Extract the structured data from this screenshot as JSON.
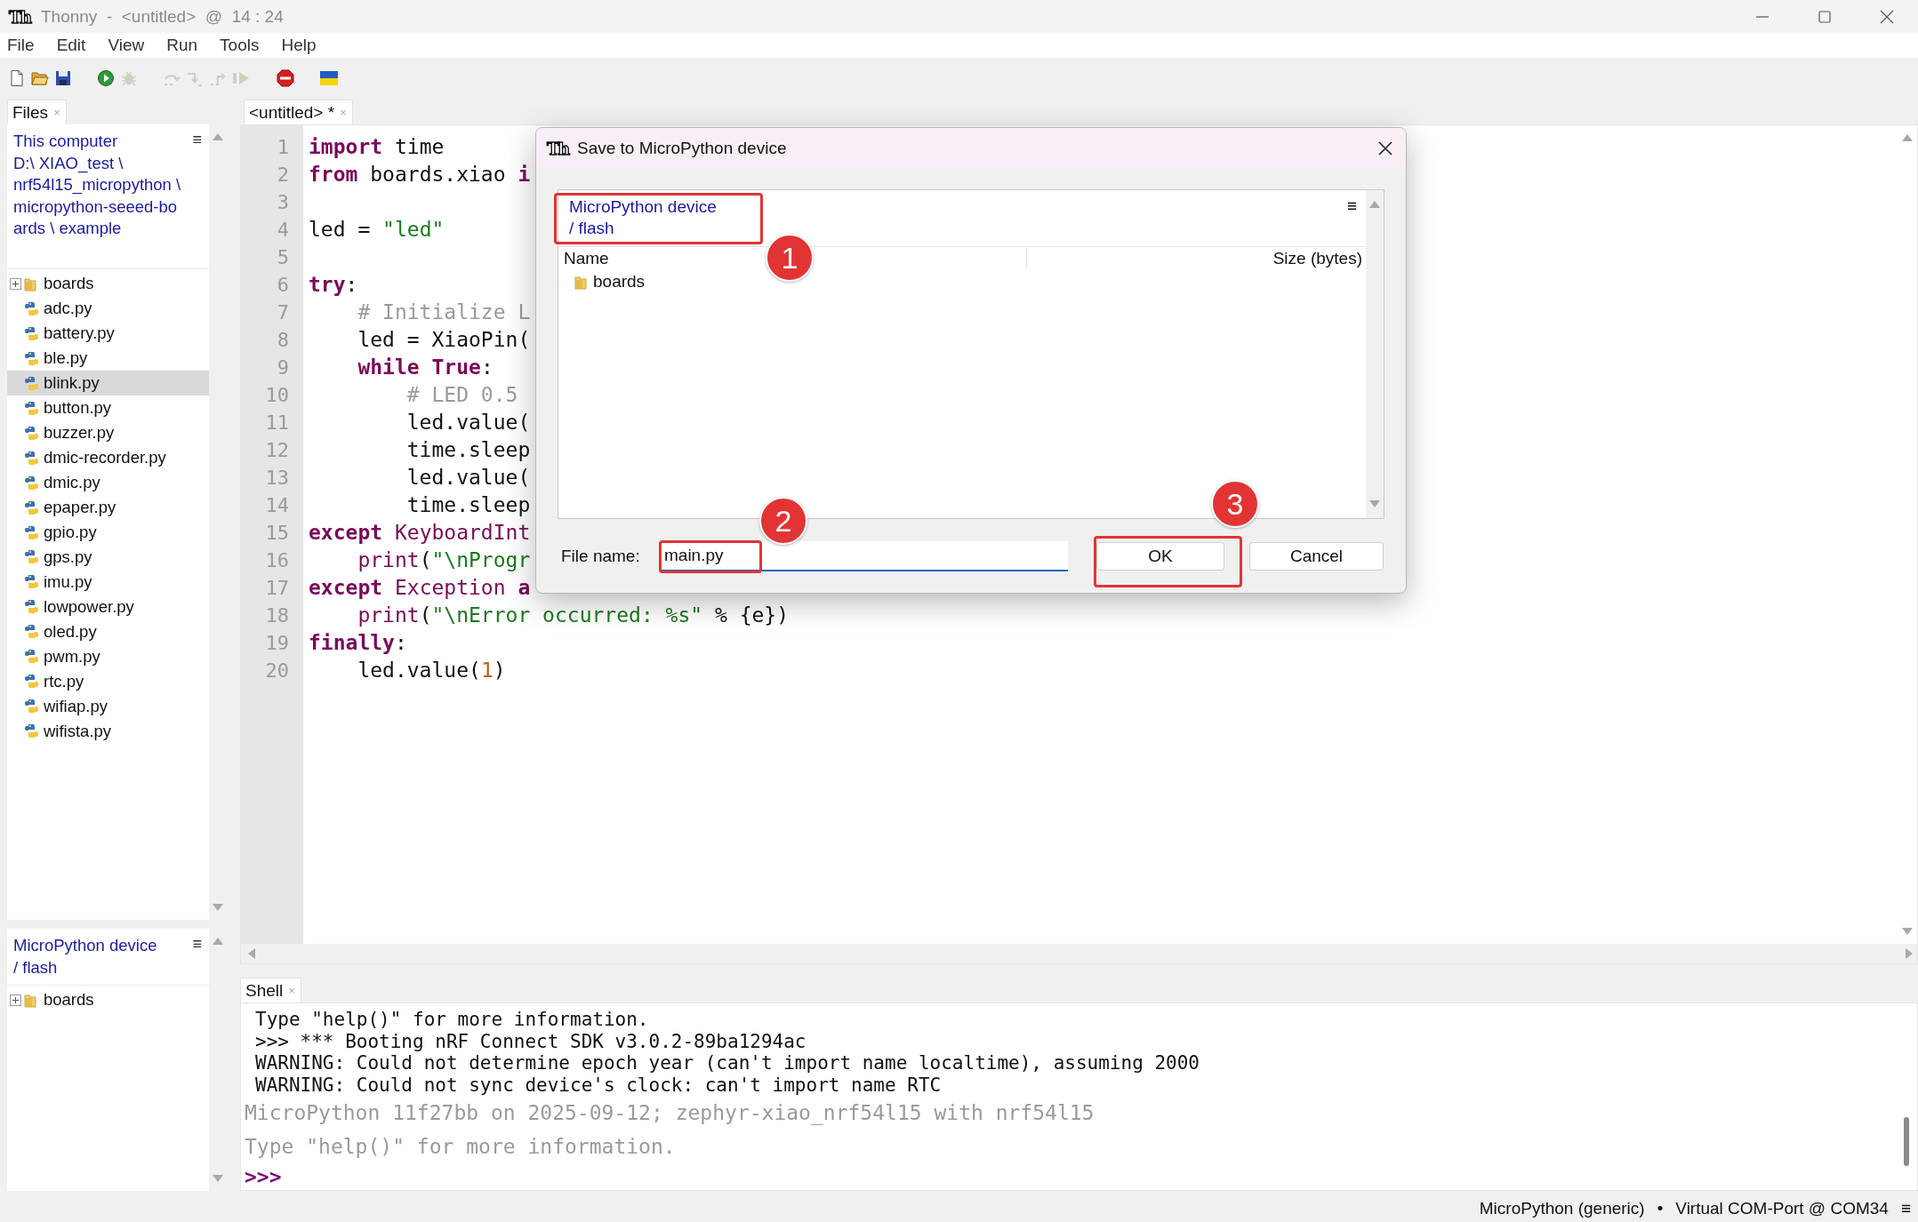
{
  "window": {
    "logo": "Th",
    "title": "Thonny  -  <untitled>  @  14 : 24"
  },
  "menu": [
    "File",
    "Edit",
    "View",
    "Run",
    "Tools",
    "Help"
  ],
  "toolbar": [
    {
      "kind": "new",
      "disabled": false
    },
    {
      "kind": "open",
      "disabled": false
    },
    {
      "kind": "save",
      "disabled": false
    },
    {
      "kind": "run",
      "disabled": false
    },
    {
      "kind": "debug",
      "disabled": true
    },
    {
      "kind": "step-over",
      "disabled": true
    },
    {
      "kind": "step-into",
      "disabled": true
    },
    {
      "kind": "step-out",
      "disabled": true
    },
    {
      "kind": "resume",
      "disabled": true
    },
    {
      "kind": "stop",
      "disabled": false
    },
    {
      "kind": "flag",
      "disabled": false
    }
  ],
  "files_panel": {
    "tab": "Files",
    "close": "×",
    "menu": "≡",
    "path": [
      "This computer",
      "D:\\ XIAO_test \\",
      "nrf54l15_micropython \\",
      "micropython-seeed-bo",
      "ards \\ example"
    ],
    "items": [
      {
        "kind": "folder",
        "name": "boards",
        "selected": false
      },
      {
        "kind": "file",
        "name": "adc.py",
        "selected": false
      },
      {
        "kind": "file",
        "name": "battery.py",
        "selected": false
      },
      {
        "kind": "file",
        "name": "ble.py",
        "selected": false
      },
      {
        "kind": "file",
        "name": "blink.py",
        "selected": true
      },
      {
        "kind": "file",
        "name": "button.py",
        "selected": false
      },
      {
        "kind": "file",
        "name": "buzzer.py",
        "selected": false
      },
      {
        "kind": "file",
        "name": "dmic-recorder.py",
        "selected": false
      },
      {
        "kind": "file",
        "name": "dmic.py",
        "selected": false
      },
      {
        "kind": "file",
        "name": "epaper.py",
        "selected": false
      },
      {
        "kind": "file",
        "name": "gpio.py",
        "selected": false
      },
      {
        "kind": "file",
        "name": "gps.py",
        "selected": false
      },
      {
        "kind": "file",
        "name": "imu.py",
        "selected": false
      },
      {
        "kind": "file",
        "name": "lowpower.py",
        "selected": false
      },
      {
        "kind": "file",
        "name": "oled.py",
        "selected": false
      },
      {
        "kind": "file",
        "name": "pwm.py",
        "selected": false
      },
      {
        "kind": "file",
        "name": "rtc.py",
        "selected": false
      },
      {
        "kind": "file",
        "name": "wifiap.py",
        "selected": false
      },
      {
        "kind": "file",
        "name": "wifista.py",
        "selected": false
      }
    ]
  },
  "device_panel": {
    "menu": "≡",
    "path": [
      "MicroPython device",
      "/ flash"
    ],
    "items": [
      {
        "kind": "folder",
        "name": "boards",
        "selected": false
      }
    ]
  },
  "editor": {
    "tab": "<untitled> *",
    "close": "×",
    "lines": [
      {
        "number": "1",
        "tokens": [
          {
            "kind": "keyword",
            "text": "import"
          },
          {
            "kind": "plain",
            "text": " time"
          }
        ]
      },
      {
        "number": "2",
        "tokens": [
          {
            "kind": "keyword",
            "text": "from"
          },
          {
            "kind": "plain",
            "text": " boards.xiao "
          },
          {
            "kind": "keyword",
            "text": "i"
          }
        ]
      },
      {
        "number": "3"
      },
      {
        "number": "4",
        "tokens": [
          {
            "kind": "plain",
            "text": "led = "
          },
          {
            "kind": "string",
            "text": "\"led\""
          }
        ]
      },
      {
        "number": "5"
      },
      {
        "number": "6",
        "tokens": [
          {
            "kind": "keyword",
            "text": "try"
          },
          {
            "kind": "plain",
            "text": ":"
          }
        ]
      },
      {
        "number": "7",
        "tokens": [
          {
            "kind": "comment",
            "text": "    # Initialize L"
          }
        ]
      },
      {
        "number": "8",
        "tokens": [
          {
            "kind": "plain",
            "text": "    led = XiaoPin("
          }
        ]
      },
      {
        "number": "9",
        "tokens": [
          {
            "kind": "keyword",
            "text": "    while"
          },
          {
            "kind": "keyword",
            "text": " True"
          },
          {
            "kind": "plain",
            "text": ":"
          }
        ]
      },
      {
        "number": "10",
        "tokens": [
          {
            "kind": "comment",
            "text": "        # LED 0.5"
          }
        ]
      },
      {
        "number": "11",
        "tokens": [
          {
            "kind": "plain",
            "text": "        led.value("
          }
        ]
      },
      {
        "number": "12",
        "tokens": [
          {
            "kind": "plain",
            "text": "        time.sleep"
          }
        ]
      },
      {
        "number": "13",
        "tokens": [
          {
            "kind": "plain",
            "text": "        led.value("
          }
        ]
      },
      {
        "number": "14",
        "tokens": [
          {
            "kind": "plain",
            "text": "        time.sleep"
          }
        ]
      },
      {
        "number": "15",
        "tokens": [
          {
            "kind": "keyword",
            "text": "except"
          },
          {
            "kind": "builtin",
            "text": " KeyboardInt"
          }
        ]
      },
      {
        "number": "16",
        "tokens": [
          {
            "kind": "builtin",
            "text": "    print"
          },
          {
            "kind": "plain",
            "text": "("
          },
          {
            "kind": "string",
            "text": "\"\\nProgr"
          }
        ]
      },
      {
        "number": "17",
        "tokens": [
          {
            "kind": "keyword",
            "text": "except"
          },
          {
            "kind": "builtin",
            "text": " Exception"
          },
          {
            "kind": "keyword",
            "text": " a"
          }
        ]
      },
      {
        "number": "18",
        "tokens": [
          {
            "kind": "builtin",
            "text": "    print"
          },
          {
            "kind": "plain",
            "text": "("
          },
          {
            "kind": "string",
            "text": "\"\\nError occurred: %s\""
          },
          {
            "kind": "plain",
            "text": " % {e})"
          }
        ]
      },
      {
        "number": "19",
        "tokens": [
          {
            "kind": "keyword",
            "text": "finally"
          },
          {
            "kind": "plain",
            "text": ":"
          }
        ]
      },
      {
        "number": "20",
        "tokens": [
          {
            "kind": "plain",
            "text": "    led.value("
          },
          {
            "kind": "number",
            "text": "1"
          },
          {
            "kind": "plain",
            "text": ")"
          }
        ]
      }
    ]
  },
  "shell": {
    "tab": "Shell",
    "close": "×",
    "lines": [
      {
        "kind": "output",
        "text": "Type \"help()\" for more information."
      },
      {
        "kind": "output",
        "text": ">>> *** Booting nRF Connect SDK v3.0.2-89ba1294ac"
      },
      {
        "kind": "output",
        "text": "WARNING: Could not determine epoch year (can't import name localtime), assuming 2000"
      },
      {
        "kind": "output",
        "text": "WARNING: Could not sync device's clock: can't import name RTC"
      },
      {
        "kind": "banner",
        "text": "MicroPython 11f27bb on 2025-09-12; zephyr-xiao_nrf54l15 with nrf54l15"
      },
      {
        "kind": "banner",
        "text": "Type \"help()\" for more information."
      },
      {
        "kind": "prompt",
        "text": ">>>"
      }
    ]
  },
  "status_bar": {
    "interpreter": "MicroPython (generic)",
    "separator": "•",
    "port": "Virtual COM-Port @ COM34",
    "menu": "≡"
  },
  "dialog": {
    "logo": "Th",
    "title": "Save to MicroPython device",
    "path": [
      "MicroPython device",
      "/ flash"
    ],
    "menu": "≡",
    "columns": [
      "Name",
      "Size (bytes)"
    ],
    "rows": [
      {
        "kind": "folder",
        "name": "boards"
      }
    ],
    "file_name_label": "File name:",
    "file_name": "main.py",
    "buttons": [
      "OK",
      "Cancel"
    ],
    "annotations": [
      {
        "text": "1"
      },
      {
        "text": "2"
      },
      {
        "text": "3"
      }
    ]
  }
}
